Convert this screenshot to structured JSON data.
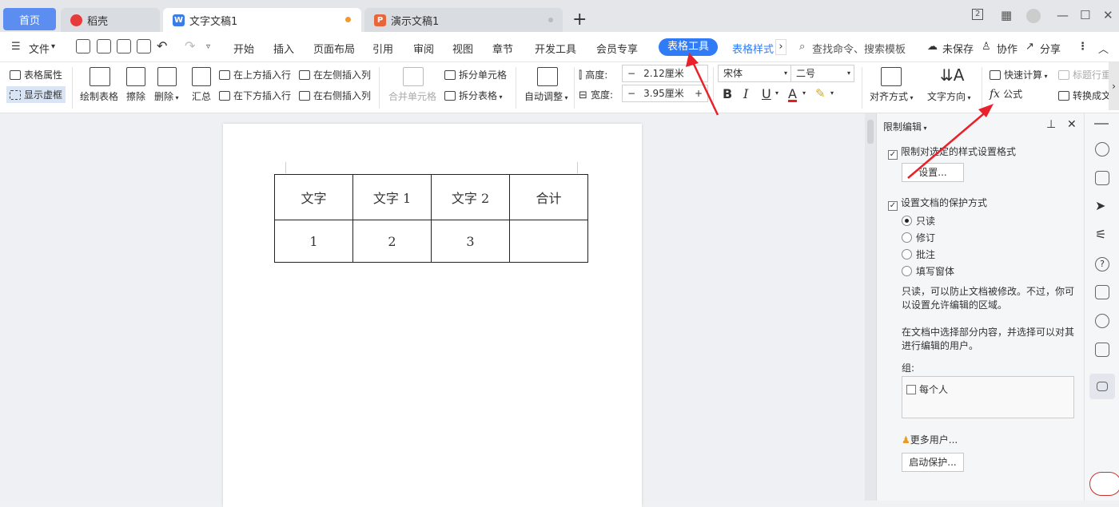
{
  "tabs": [
    {
      "label": "首页"
    },
    {
      "label": "稻壳"
    },
    {
      "label": "文字文稿1"
    },
    {
      "label": "演示文稿1"
    }
  ],
  "window": {
    "page_indicator": "2"
  },
  "menu": {
    "file": "文件",
    "items": [
      "开始",
      "插入",
      "页面布局",
      "引用",
      "审阅",
      "视图",
      "章节",
      "开发工具",
      "会员专享"
    ],
    "active_pill": "表格工具",
    "table_style": "表格样式",
    "search_placeholder": "查找命令、搜索模板",
    "unsaved": "未保存",
    "collab": "协作",
    "share": "分享"
  },
  "ribbon": {
    "table_props": "表格属性",
    "show_grid": "显示虚框",
    "draw_table": "绘制表格",
    "erase": "擦除",
    "delete": "删除",
    "summary": "汇总",
    "insert_above": "在上方插入行",
    "insert_below": "在下方插入行",
    "insert_left": "在左侧插入列",
    "insert_right": "在右侧插入列",
    "merge_cells": "合并单元格",
    "split_cells": "拆分单元格",
    "split_table": "拆分表格",
    "auto_adjust": "自动调整",
    "height_label": "高度:",
    "height_value": "2.12厘米",
    "width_label": "宽度:",
    "width_value": "3.95厘米",
    "font_name": "宋体",
    "font_size": "二号",
    "align": "对齐方式",
    "text_dir": "文字方向",
    "quick_calc": "快速计算",
    "title_row": "标题行重",
    "formula": "公式",
    "convert": "转换成文"
  },
  "document": {
    "header_row": [
      "文字",
      "文字 1",
      "文字 2",
      "合计"
    ],
    "data_row": [
      "1",
      "2",
      "3",
      ""
    ]
  },
  "pane": {
    "title": "限制编辑",
    "restrict_format": "限制对选定的样式设置格式",
    "settings_btn": "设置...",
    "protect_doc": "设置文档的保护方式",
    "options": [
      "只读",
      "修订",
      "批注",
      "填写窗体"
    ],
    "selected_option": "只读",
    "desc1": "只读，可以防止文档被修改。不过，你可以设置允许编辑的区域。",
    "desc2": "在文档中选择部分内容，并选择可以对其进行编辑的用户。",
    "group_label": "组:",
    "everyone": "每个人",
    "more_users": "更多用户...",
    "start_protect": "启动保护..."
  },
  "colors": {
    "accent": "#2f7cf6",
    "home_tab": "#5b8ef0",
    "arrow": "#e8212a"
  }
}
